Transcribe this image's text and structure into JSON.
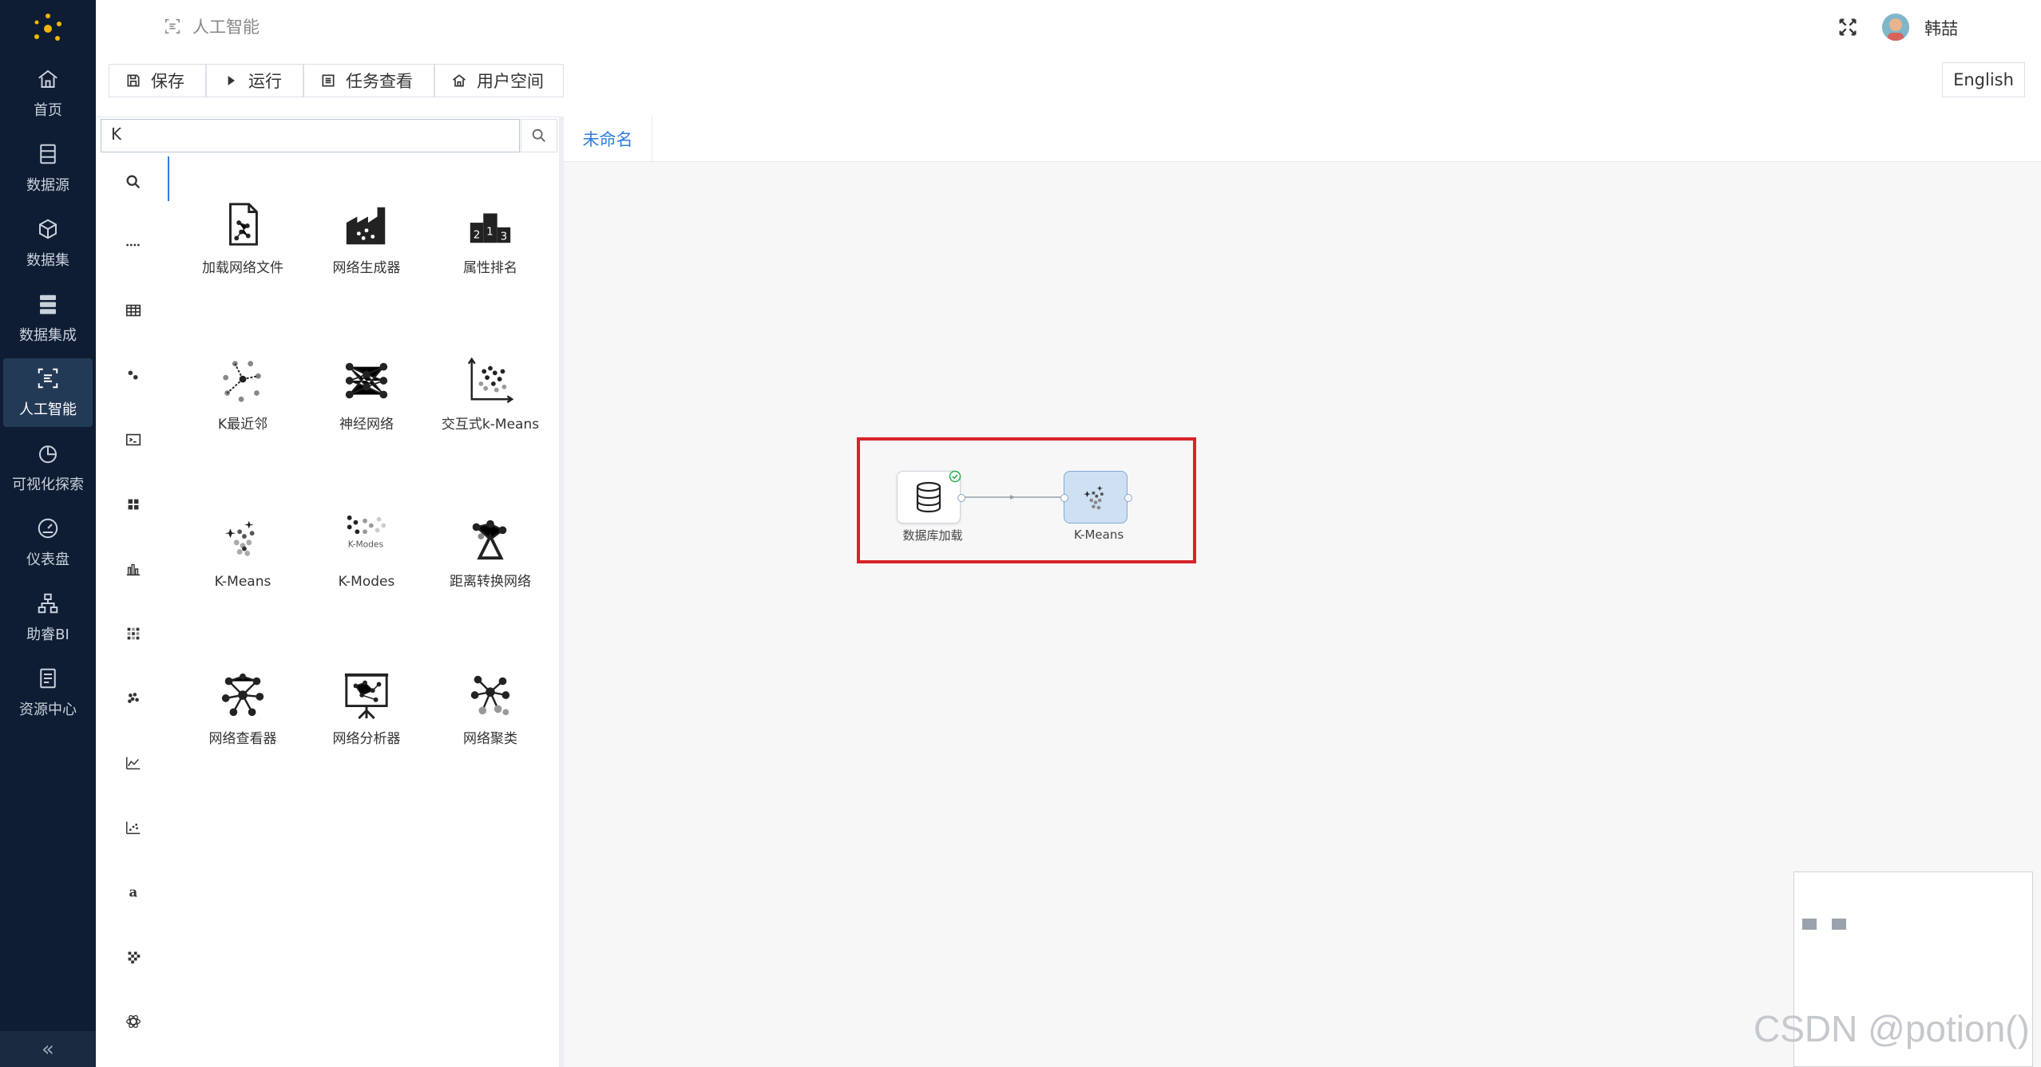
{
  "nav": {
    "items": [
      {
        "label": "首页",
        "icon": "home-icon"
      },
      {
        "label": "数据源",
        "icon": "datasource-icon"
      },
      {
        "label": "数据集",
        "icon": "dataset-cube-icon"
      },
      {
        "label": "数据集成",
        "icon": "data-integration-icon"
      },
      {
        "label": "人工智能",
        "icon": "ai-icon",
        "active": true
      },
      {
        "label": "可视化探索",
        "icon": "pie-chart-icon"
      },
      {
        "label": "仪表盘",
        "icon": "dashboard-gauge-icon"
      },
      {
        "label": "助睿BI",
        "icon": "org-chart-icon"
      },
      {
        "label": "资源中心",
        "icon": "resource-icon"
      }
    ],
    "collapse_label": "«"
  },
  "topbar": {
    "breadcrumb": "人工智能",
    "user_name": "韩喆"
  },
  "toolbar": {
    "buttons": [
      {
        "label": "保存",
        "icon": "save-icon"
      },
      {
        "label": "运行",
        "icon": "play-icon"
      },
      {
        "label": "任务查看",
        "icon": "list-icon"
      },
      {
        "label": "用户空间",
        "icon": "home-icon"
      }
    ],
    "language": "English"
  },
  "search": {
    "value": "K"
  },
  "widgets": [
    {
      "label": "加载网络文件",
      "icon": "network-file-icon"
    },
    {
      "label": "网络生成器",
      "icon": "network-generator-icon"
    },
    {
      "label": "属性排名",
      "icon": "podium-icon"
    },
    {
      "label": "K最近邻",
      "icon": "knn-icon"
    },
    {
      "label": "神经网络",
      "icon": "neural-network-icon"
    },
    {
      "label": "交互式k-Means",
      "icon": "interactive-kmeans-icon"
    },
    {
      "label": "K-Means",
      "icon": "kmeans-icon"
    },
    {
      "label": "K-Modes",
      "icon": "kmodes-icon"
    },
    {
      "label": "距离转换网络",
      "icon": "distance-network-icon"
    },
    {
      "label": "网络查看器",
      "icon": "network-viewer-icon"
    },
    {
      "label": "网络分析器",
      "icon": "network-analyzer-icon"
    },
    {
      "label": "网络聚类",
      "icon": "network-clustering-icon"
    }
  ],
  "categories": [
    "search-icon",
    "dots-icon",
    "table-icon",
    "transform-icon",
    "terminal-icon",
    "grid-icon",
    "bar-chart-icon",
    "heatmap-icon",
    "cluster-icon",
    "line-chart-icon",
    "scatter-icon",
    "text-icon",
    "checker-icon",
    "atom-icon"
  ],
  "canvas": {
    "tab_label": "未命名",
    "nodes": [
      {
        "label": "数据库加载",
        "icon": "database-icon",
        "status": "ok"
      },
      {
        "label": "K-Means",
        "icon": "kmeans-icon"
      }
    ]
  },
  "watermark": "CSDN @potion()",
  "colors": {
    "sidebar": "#0e1d33",
    "accent": "#2f7de1",
    "highlight": "#d7232a"
  }
}
